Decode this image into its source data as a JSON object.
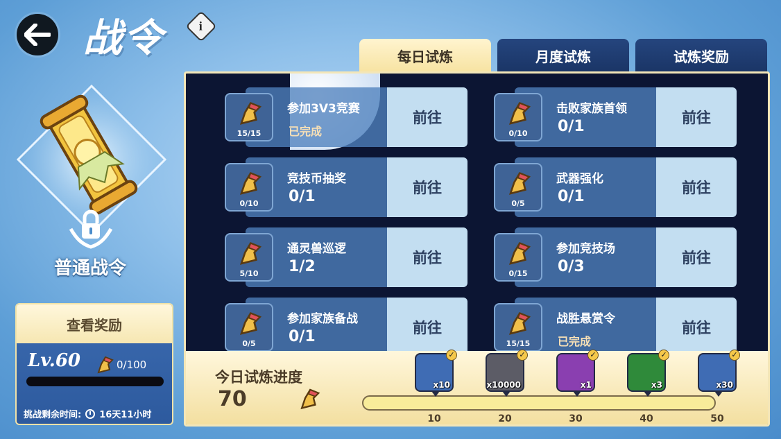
{
  "header": {
    "title": "战令",
    "info_label": "i"
  },
  "pass": {
    "name": "普通战令"
  },
  "reward_card": {
    "view_rewards_label": "查看奖励",
    "level": "Lv.60",
    "level_progress": "0/100",
    "level_progress_fraction": 0,
    "remaining_label": "挑战剩余时间:",
    "remaining_time": "16天11小时"
  },
  "tabs": [
    {
      "label": "每日试炼",
      "active": true
    },
    {
      "label": "月度试炼",
      "active": false
    },
    {
      "label": "试炼奖励",
      "active": false
    }
  ],
  "quests": [
    {
      "title": "参加3V3竞赛",
      "status": "已完成",
      "count": "15/15",
      "go": "前往"
    },
    {
      "title": "击败家族首领",
      "status": "0/1",
      "count": "0/10",
      "go": "前往"
    },
    {
      "title": "竞技币抽奖",
      "status": "0/1",
      "count": "0/10",
      "go": "前往"
    },
    {
      "title": "武器强化",
      "status": "0/1",
      "count": "0/5",
      "go": "前往"
    },
    {
      "title": "通灵兽巡逻",
      "status": "1/2",
      "count": "5/10",
      "go": "前往"
    },
    {
      "title": "参加竞技场",
      "status": "0/3",
      "count": "0/15",
      "go": "前往"
    },
    {
      "title": "参加家族备战",
      "status": "0/1",
      "count": "0/5",
      "go": "前往"
    },
    {
      "title": "战胜悬赏令",
      "status": "已完成",
      "count": "15/15",
      "go": "前往"
    }
  ],
  "progress": {
    "label": "今日试炼进度",
    "value": "70",
    "milestones": [
      {
        "amount": "x10",
        "tick": "10",
        "icon": "green-gem-icon",
        "color": "#3f6cb4"
      },
      {
        "amount": "x10000",
        "tick": "20",
        "icon": "coin-icon",
        "color": "#5c5c66"
      },
      {
        "amount": "x1",
        "tick": "30",
        "icon": "red-pot-icon",
        "color": "#8a3fb0"
      },
      {
        "amount": "x3",
        "tick": "40",
        "icon": "key-icon",
        "color": "#2f8a3a"
      },
      {
        "amount": "x30",
        "tick": "50",
        "icon": "green-spirit-icon",
        "color": "#3f6cb4"
      }
    ],
    "check": "✓"
  }
}
